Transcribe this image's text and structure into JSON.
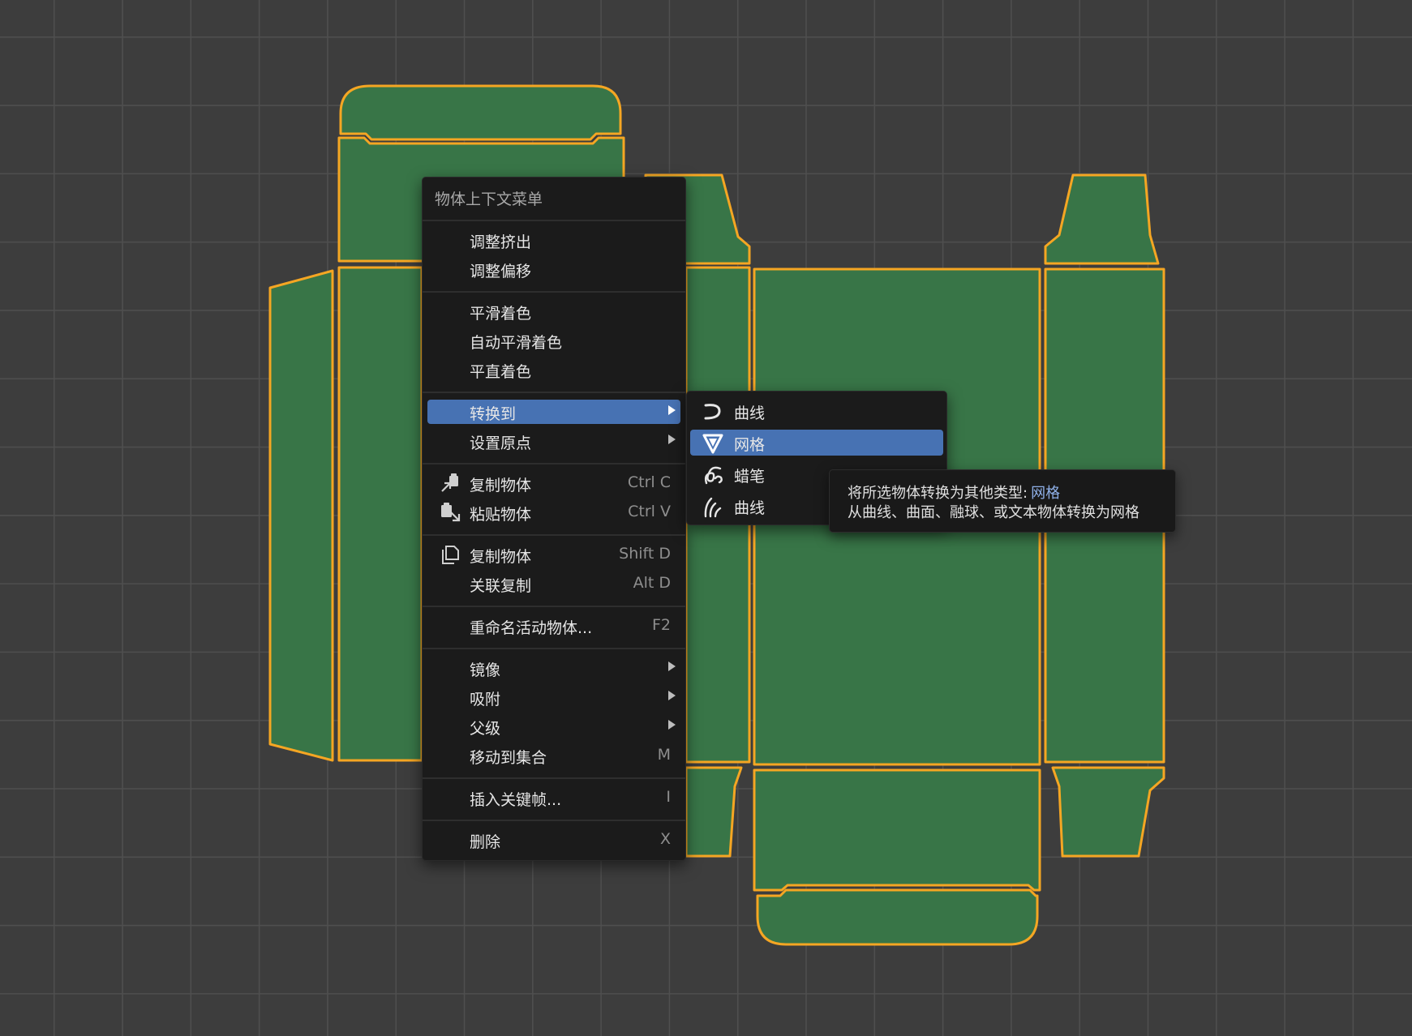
{
  "menu": {
    "title": "物体上下文菜单",
    "items": [
      {
        "label": "调整挤出",
        "shortcut": "",
        "icon": "",
        "has_submenu": false
      },
      {
        "label": "调整偏移",
        "shortcut": "",
        "icon": "",
        "has_submenu": false
      },
      {
        "label": "平滑着色",
        "shortcut": "",
        "icon": "",
        "has_submenu": false
      },
      {
        "label": "自动平滑着色",
        "shortcut": "",
        "icon": "",
        "has_submenu": false
      },
      {
        "label": "平直着色",
        "shortcut": "",
        "icon": "",
        "has_submenu": false
      },
      {
        "label": "转换到",
        "shortcut": "",
        "icon": "",
        "has_submenu": true,
        "active": true
      },
      {
        "label": "设置原点",
        "shortcut": "",
        "icon": "",
        "has_submenu": true
      },
      {
        "label": "复制物体",
        "shortcut": "Ctrl C",
        "icon": "copy-to-buffer-icon",
        "has_submenu": false
      },
      {
        "label": "粘贴物体",
        "shortcut": "Ctrl V",
        "icon": "paste-from-buffer-icon",
        "has_submenu": false
      },
      {
        "label": "复制物体",
        "shortcut": "Shift D",
        "icon": "duplicate-icon",
        "has_submenu": false
      },
      {
        "label": "关联复制",
        "shortcut": "Alt D",
        "icon": "",
        "has_submenu": false
      },
      {
        "label": "重命名活动物体...",
        "shortcut": "F2",
        "icon": "",
        "has_submenu": false
      },
      {
        "label": "镜像",
        "shortcut": "",
        "icon": "",
        "has_submenu": true
      },
      {
        "label": "吸附",
        "shortcut": "",
        "icon": "",
        "has_submenu": true
      },
      {
        "label": "父级",
        "shortcut": "",
        "icon": "",
        "has_submenu": true
      },
      {
        "label": "移动到集合",
        "shortcut": "M",
        "icon": "",
        "has_submenu": false
      },
      {
        "label": "插入关键帧...",
        "shortcut": "I",
        "icon": "",
        "has_submenu": false
      },
      {
        "label": "删除",
        "shortcut": "X",
        "icon": "",
        "has_submenu": false
      }
    ]
  },
  "submenu": {
    "items": [
      {
        "label": "曲线",
        "icon": "curve-icon"
      },
      {
        "label": "网格",
        "icon": "mesh-icon",
        "active": true
      },
      {
        "label": "蜡笔",
        "icon": "grease-pencil-icon"
      },
      {
        "label": "曲线",
        "icon": "curves-hair-icon"
      }
    ]
  },
  "tooltip": {
    "line1_prefix": "将所选物体转换为其他类型:",
    "line1_value": "网格",
    "line2": "从曲线、曲面、融球、或文本物体转换为网格"
  },
  "colors": {
    "viewport_bg": "#3d3d3d",
    "grid_line": "#4f4f4f",
    "panel_fill": "#387547",
    "selection_outline": "#f5a623",
    "menu_bg": "#1b1b1b",
    "highlight": "#4772b3",
    "tooltip_value": "#8fb0e8"
  }
}
